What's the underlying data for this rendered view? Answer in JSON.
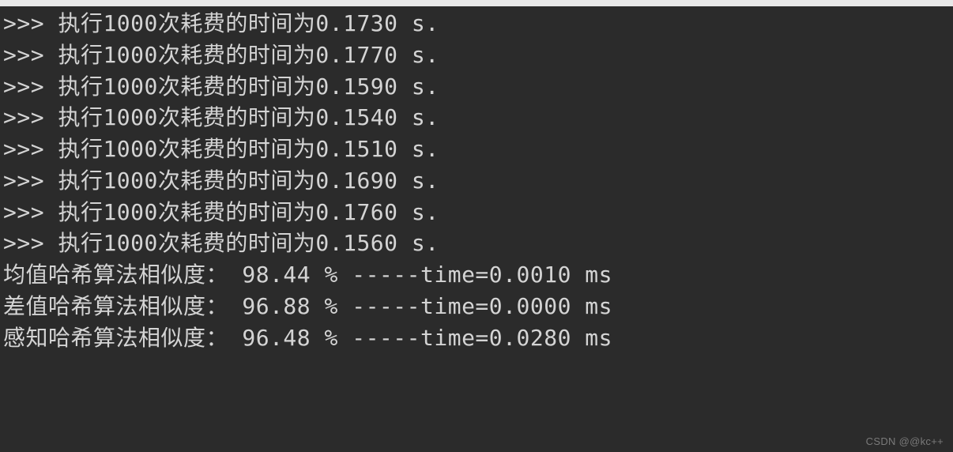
{
  "terminal": {
    "lines": [
      {
        "prompt": ">>> ",
        "text": "执行1000次耗费的时间为0.1730 s."
      },
      {
        "prompt": ">>> ",
        "text": "执行1000次耗费的时间为0.1770 s."
      },
      {
        "prompt": ">>> ",
        "text": "执行1000次耗费的时间为0.1590 s."
      },
      {
        "prompt": ">>> ",
        "text": "执行1000次耗费的时间为0.1540 s."
      },
      {
        "prompt": ">>> ",
        "text": "执行1000次耗费的时间为0.1510 s."
      },
      {
        "prompt": ">>> ",
        "text": "执行1000次耗费的时间为0.1690 s."
      },
      {
        "prompt": ">>> ",
        "text": "执行1000次耗费的时间为0.1760 s."
      },
      {
        "prompt": ">>> ",
        "text": "执行1000次耗费的时间为0.1560 s."
      },
      {
        "prompt": "",
        "text": "均值哈希算法相似度： 98.44 % -----time=0.0010 ms"
      },
      {
        "prompt": "",
        "text": "差值哈希算法相似度： 96.88 % -----time=0.0000 ms"
      },
      {
        "prompt": "",
        "text": "感知哈希算法相似度： 96.48 % -----time=0.0280 ms"
      }
    ]
  },
  "watermark": "CSDN @@kc++"
}
